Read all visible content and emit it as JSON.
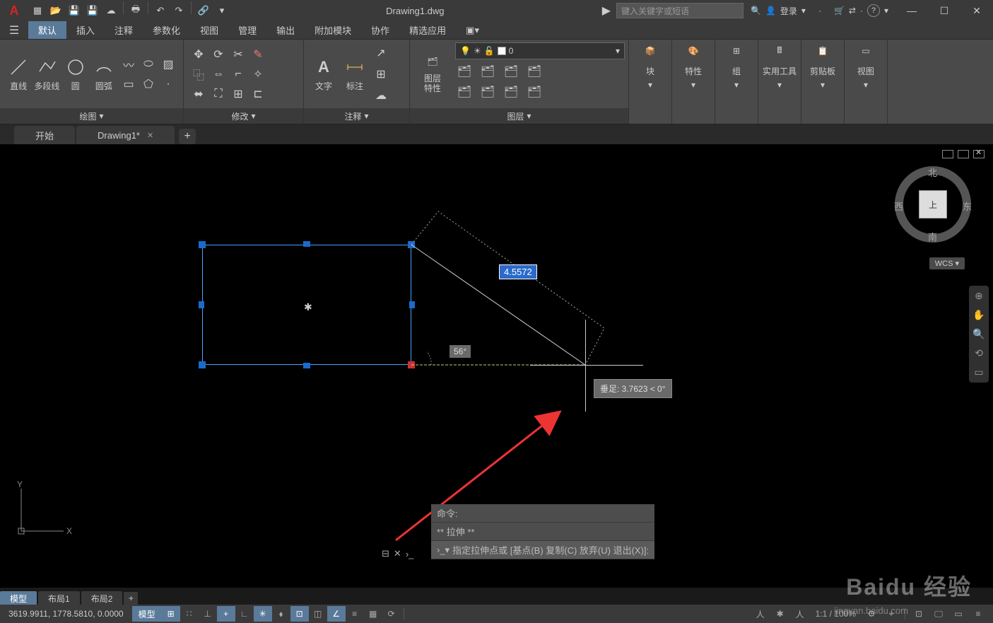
{
  "title": "Drawing1.dwg",
  "search_placeholder": "键入关键字或短语",
  "login_label": "登录",
  "ribbon_tabs": [
    "默认",
    "插入",
    "注释",
    "参数化",
    "视图",
    "管理",
    "输出",
    "附加模块",
    "协作",
    "精选应用"
  ],
  "panels": {
    "draw": {
      "title": "绘图",
      "tools": [
        "直线",
        "多段线",
        "圆",
        "圆弧"
      ]
    },
    "modify": {
      "title": "修改"
    },
    "annotate": {
      "title": "注释",
      "tools": [
        "文字",
        "标注"
      ]
    },
    "layers": {
      "title": "图层",
      "mgr": "图层\n特性",
      "current": "0"
    },
    "block": "块",
    "properties": "特性",
    "group": "组",
    "utilities": "实用工具",
    "clipboard": "剪贴板",
    "view": "视图"
  },
  "file_tabs": {
    "start": "开始",
    "doc": "Drawing1*"
  },
  "viewcube": {
    "n": "北",
    "s": "南",
    "e": "东",
    "w": "西",
    "top": "上",
    "wcs": "WCS"
  },
  "drawing": {
    "dim_value": "4.5572",
    "angle": "56°",
    "tooltip": "垂足: 3.7623 < 0°"
  },
  "command": {
    "hist1": "命令:",
    "hist2": "** 拉伸 **",
    "prompt": "指定拉伸点或 [基点(B) 复制(C) 放弃(U) 退出(X)]:"
  },
  "layout_tabs": [
    "模型",
    "布局1",
    "布局2"
  ],
  "status": {
    "coords": "3619.9911, 1778.5810, 0.0000",
    "model": "模型",
    "scale": "1:1 / 100%"
  },
  "watermark": "Baidu 经验",
  "watermark_sub": "jingyan.baidu.com"
}
